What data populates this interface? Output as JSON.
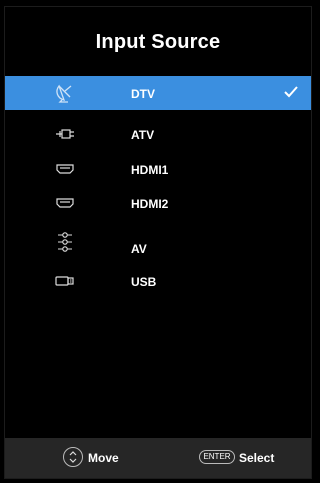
{
  "menu": {
    "title": "Input Source",
    "items": [
      {
        "label": "DTV",
        "icon": "satellite-dish-icon",
        "selected": true
      },
      {
        "label": "ATV",
        "icon": "antenna-plug-icon",
        "selected": false
      },
      {
        "label": "HDMI1",
        "icon": "hdmi-port-icon",
        "selected": false
      },
      {
        "label": "HDMI2",
        "icon": "hdmi-port-icon",
        "selected": false
      },
      {
        "label": "AV",
        "icon": "av-connector-icon",
        "selected": false
      },
      {
        "label": "USB",
        "icon": "usb-icon",
        "selected": false
      }
    ]
  },
  "footer": {
    "move_label": "Move",
    "enter_key": "ENTER",
    "select_label": "Select"
  },
  "colors": {
    "highlight": "#3b8fe0",
    "background": "#000000",
    "footer_bg": "#262626",
    "text": "#ffffff"
  }
}
